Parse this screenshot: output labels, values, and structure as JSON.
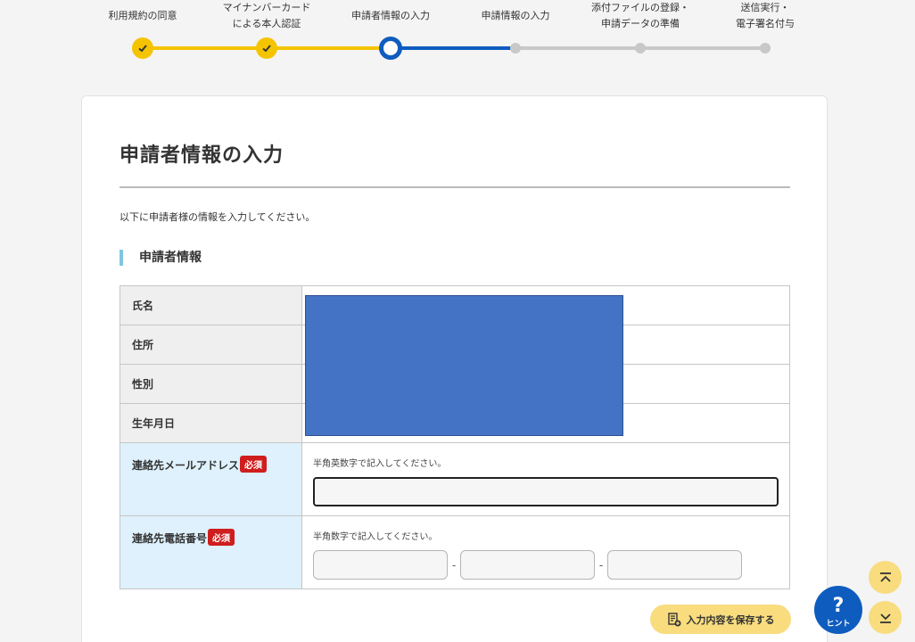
{
  "stepper": {
    "steps": [
      {
        "label": "利用規約の同意",
        "state": "done"
      },
      {
        "label": "マイナンバーカード\nによる本人認証",
        "state": "done"
      },
      {
        "label": "申請者情報の入力",
        "state": "current"
      },
      {
        "label": "申請情報の入力",
        "state": "todo"
      },
      {
        "label": "添付ファイルの登録・\n申請データの準備",
        "state": "todo"
      },
      {
        "label": "送信実行・\n電子署名付与",
        "state": "todo"
      }
    ]
  },
  "colors": {
    "done": "#f5c400",
    "current": "#0f5cbf",
    "todo": "#c8c8c8",
    "required_badge": "#cf1e1e",
    "save_button": "#f8dc7e",
    "redaction": "#4472c4"
  },
  "page": {
    "title": "申請者情報の入力",
    "intro": "以下に申請者様の情報を入力してください。",
    "section_title": "申請者情報"
  },
  "table": {
    "name_label": "氏名",
    "address_label": "住所",
    "gender_label": "性別",
    "birthdate_label": "生年月日",
    "email": {
      "label": "連絡先メールアドレス",
      "required_badge": "必須",
      "hint": "半角英数字で記入してください。",
      "value": ""
    },
    "phone": {
      "label": "連絡先電話番号",
      "required_badge": "必須",
      "hint": "半角数字で記入してください。",
      "separator": "-",
      "parts": [
        "",
        "",
        ""
      ]
    }
  },
  "actions": {
    "save_label": "入力内容を保存する",
    "hint_label": "ヒント",
    "hint_glyph": "?"
  },
  "icons": {
    "save": "document-save-icon",
    "scroll_top": "scroll-top-icon",
    "scroll_bottom": "scroll-bottom-icon",
    "check": "check-icon"
  }
}
